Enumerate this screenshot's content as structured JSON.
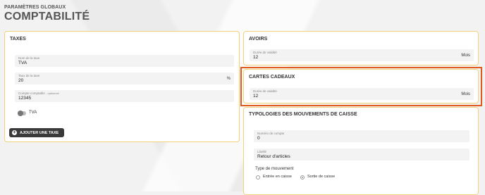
{
  "header": {
    "subtitle": "PARAMÈTRES GLOBAUX",
    "title": "COMPTABILITÉ"
  },
  "taxes": {
    "title": "TAXES",
    "fields": [
      {
        "label": "Nom de la taxe",
        "value": "TVA",
        "unit": ""
      },
      {
        "label": "Taux de la taxe",
        "value": "20",
        "unit": "%"
      },
      {
        "label": "Compte comptable",
        "optional": "- optionnel",
        "value": "12345",
        "unit": ""
      }
    ],
    "toggle_label": "TVA",
    "add_button": "AJOUTER UNE TAXE"
  },
  "avoirs": {
    "title": "AVOIRS",
    "field": {
      "label": "Durée de validité",
      "value": "12",
      "unit": "Mois"
    }
  },
  "cartes": {
    "title": "CARTES CADEAUX",
    "field": {
      "label": "Durée de validité",
      "value": "12",
      "unit": "Mois"
    }
  },
  "typologies": {
    "title": "TYPOLOGIES DES MOUVEMENTS DE CAISSE",
    "account": {
      "label": "Numéro de compte",
      "value": "0"
    },
    "libelle": {
      "label": "Libellé",
      "value": "Retour d'articles"
    },
    "movement_type_label": "Type de mouvement",
    "options": [
      "Entrée en caisse",
      "Sortie de caisse"
    ],
    "selected": "Sortie de caisse"
  },
  "colors": {
    "highlight": "#e05a1e",
    "card_border": "#f1d27a"
  }
}
